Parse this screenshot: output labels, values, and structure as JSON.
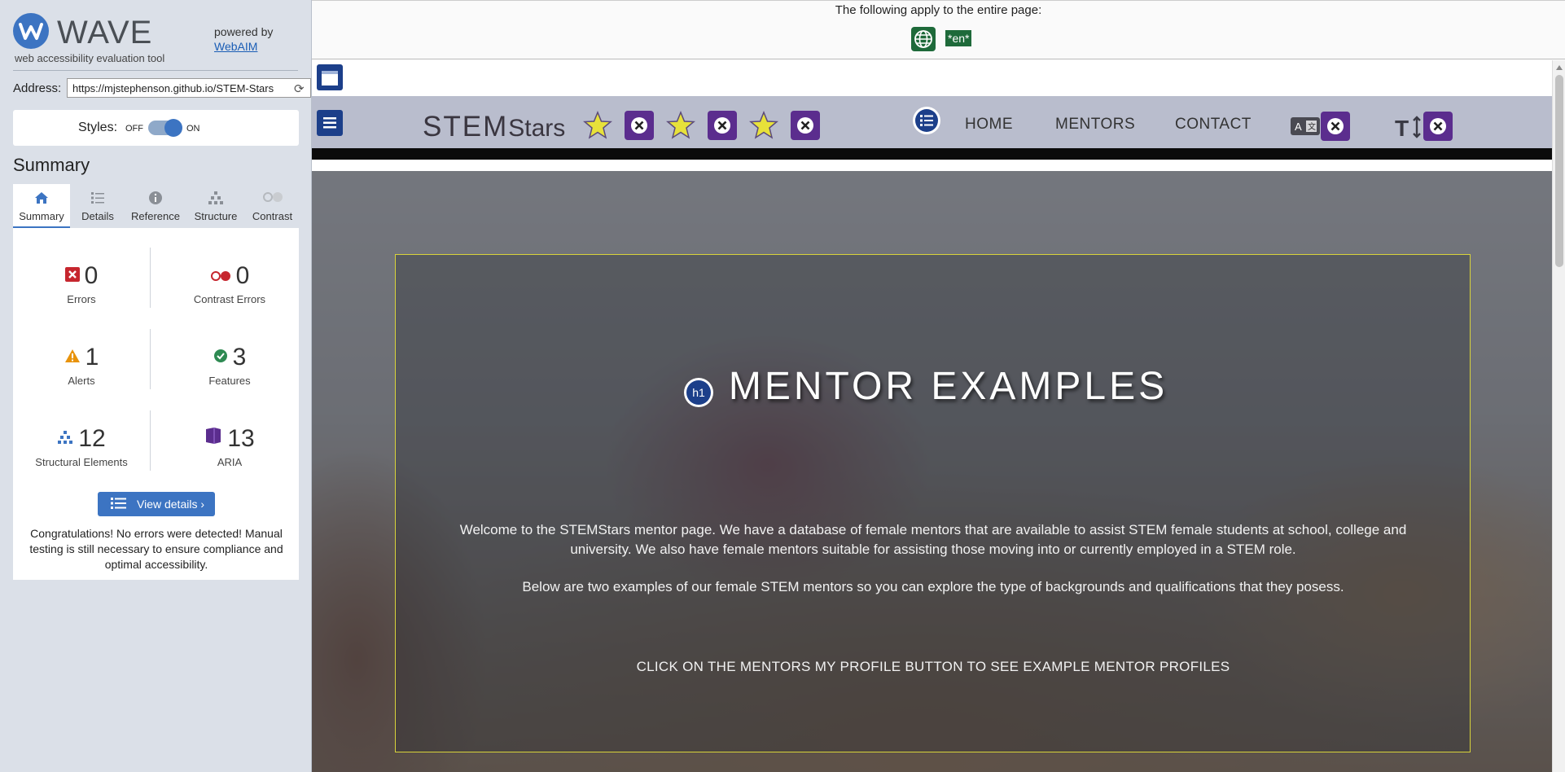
{
  "wave": {
    "logo_text": "WAVE",
    "tagline": "web accessibility evaluation tool",
    "powered_by": "powered by",
    "webaim_link": "WebAIM",
    "address_label": "Address:",
    "address_value": "https://mjstephenson.github.io/STEM-Stars",
    "styles_label": "Styles:",
    "styles_off": "OFF",
    "styles_on": "ON",
    "summary_heading": "Summary",
    "tabs": [
      {
        "label": "Summary",
        "icon": "home-icon"
      },
      {
        "label": "Details",
        "icon": "list-icon"
      },
      {
        "label": "Reference",
        "icon": "info-icon"
      },
      {
        "label": "Structure",
        "icon": "structure-icon"
      },
      {
        "label": "Contrast",
        "icon": "contrast-icon"
      }
    ],
    "stats": {
      "errors": {
        "count": "0",
        "label": "Errors"
      },
      "contrast_errors": {
        "count": "0",
        "label": "Contrast Errors"
      },
      "alerts": {
        "count": "1",
        "label": "Alerts"
      },
      "features": {
        "count": "3",
        "label": "Features"
      },
      "structural": {
        "count": "12",
        "label": "Structural Elements"
      },
      "aria": {
        "count": "13",
        "label": "ARIA"
      }
    },
    "view_details_label": "View details ›",
    "congrats": "Congratulations! No errors were detected! Manual testing is still necessary to ensure compliance and optimal accessibility."
  },
  "notice": {
    "text": "The following apply to the entire page:",
    "lang_badge": "*en*"
  },
  "site": {
    "brand_main": "STEM",
    "brand_sub": "Stars",
    "nav": [
      "HOME",
      "MENTORS",
      "CONTACT"
    ],
    "hero_title": "MENTOR EXAMPLES",
    "h1_badge": "h1",
    "hero_intro": "Welcome to the STEMStars mentor page. We have a database of female mentors that are available to assist STEM female students at school, college and university. We also have female mentors suitable for assisting those moving into or currently employed in a STEM role.",
    "hero_examples": "Below are two examples of our female STEM mentors so you can explore the type of backgrounds and qualifications that they posess.",
    "hero_cta": "CLICK ON THE MENTORS MY PROFILE BUTTON TO SEE EXAMPLE MENTOR PROFILES"
  },
  "colors": {
    "wave_blue": "#3c74c2",
    "aria_purple": "#5b2d8e",
    "error_red": "#c6262e",
    "alert_orange": "#e8930c",
    "feature_green": "#2e8a52",
    "hero_border": "#d8d33a"
  }
}
